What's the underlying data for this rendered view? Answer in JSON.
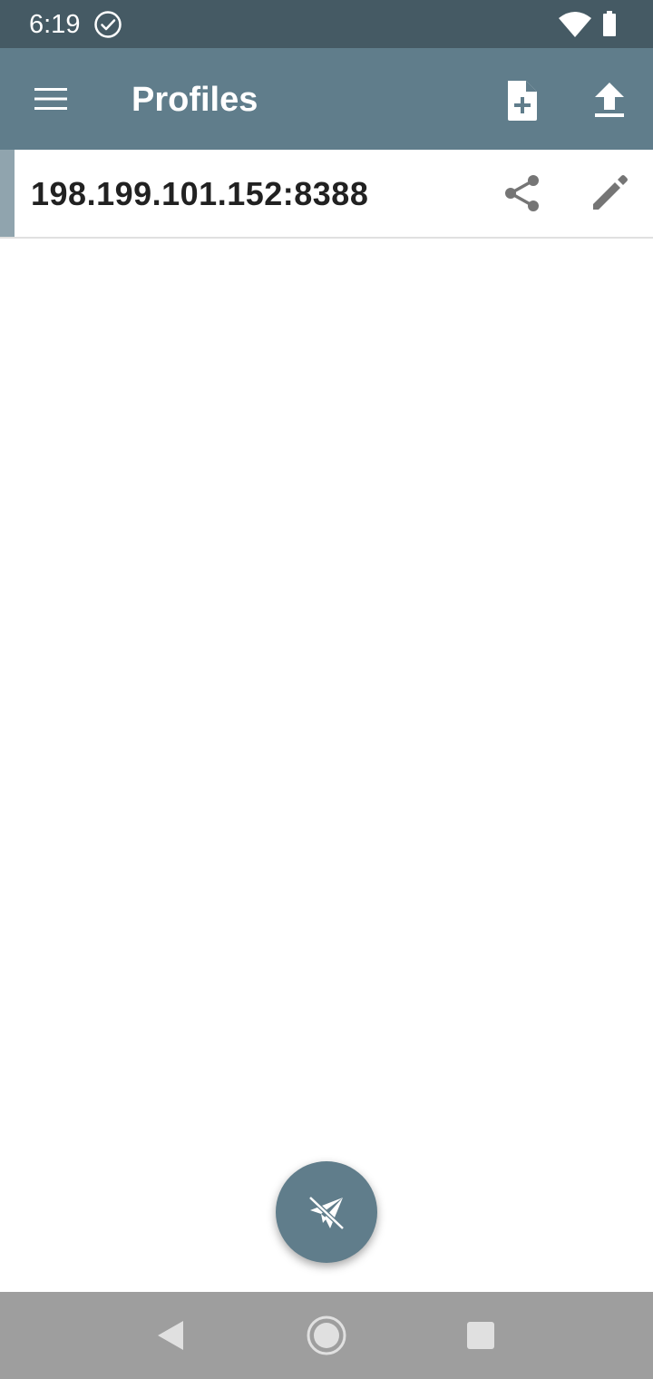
{
  "status_bar": {
    "time": "6:19",
    "icons": [
      "check-circle-icon",
      "wifi-icon",
      "battery-icon"
    ]
  },
  "app_bar": {
    "title": "Profiles",
    "actions": [
      "menu-icon",
      "add-profile-icon",
      "import-icon"
    ]
  },
  "profiles": [
    {
      "name": "198.199.101.152:8388",
      "actions": [
        "share-icon",
        "edit-icon"
      ]
    }
  ],
  "fab": {
    "icon": "disconnected-paper-plane-icon"
  },
  "nav_bar": {
    "icons": [
      "back-icon",
      "home-icon",
      "recents-icon"
    ]
  },
  "colors": {
    "status_bar": "#455a64",
    "app_bar": "#607d8b",
    "accent_indicator": "#90a4ae",
    "fab": "#607d8b",
    "nav_bar": "#9e9e9e",
    "icon_gray": "#757575"
  }
}
